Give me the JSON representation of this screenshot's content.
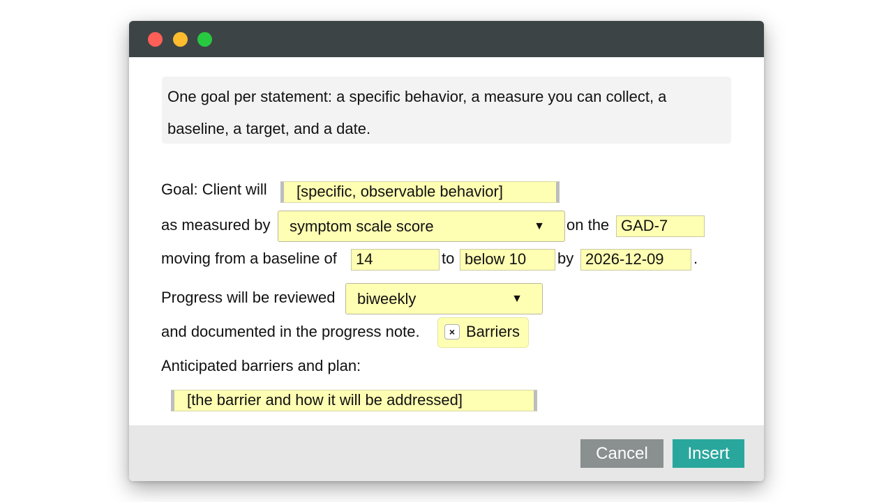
{
  "colors": {
    "titlebar": "#3d4446",
    "close_dot": "#fe5f57",
    "minimize_dot": "#febc2e",
    "zoom_dot": "#28c840",
    "field_fill": "#ffffb3",
    "cancel_button": "#8a8f90",
    "insert_button": "#2aa79d",
    "footer": "#e7e7e7"
  },
  "instructions": "One goal per statement: a specific behavior, a measure you can collect, a baseline, a target, and a date.",
  "goal": {
    "prefix": "Goal: Client will",
    "behavior_field": "[specific, observable behavior]"
  },
  "measure": {
    "prefix": "as measured by",
    "select_value": "symptom scale score",
    "caret": "▼",
    "on_the": "on the",
    "instrument_field": "GAD-7"
  },
  "baseline": {
    "prefix": "moving from a baseline of",
    "baseline_value": "14",
    "to": "to",
    "target_value": "below 10",
    "by": "by",
    "date_value": "2026-12-09",
    "period": "."
  },
  "review": {
    "prefix": "Progress will be reviewed",
    "select_value": "biweekly",
    "caret": "▼"
  },
  "documented": {
    "text": "and documented in the progress note.",
    "chip_remove": "×",
    "chip_label": "Barriers"
  },
  "barriers": {
    "heading": "Anticipated barriers and plan:",
    "field": "[the barrier and how it will be addressed]"
  },
  "footer": {
    "cancel_label": "Cancel",
    "insert_label": "Insert"
  }
}
